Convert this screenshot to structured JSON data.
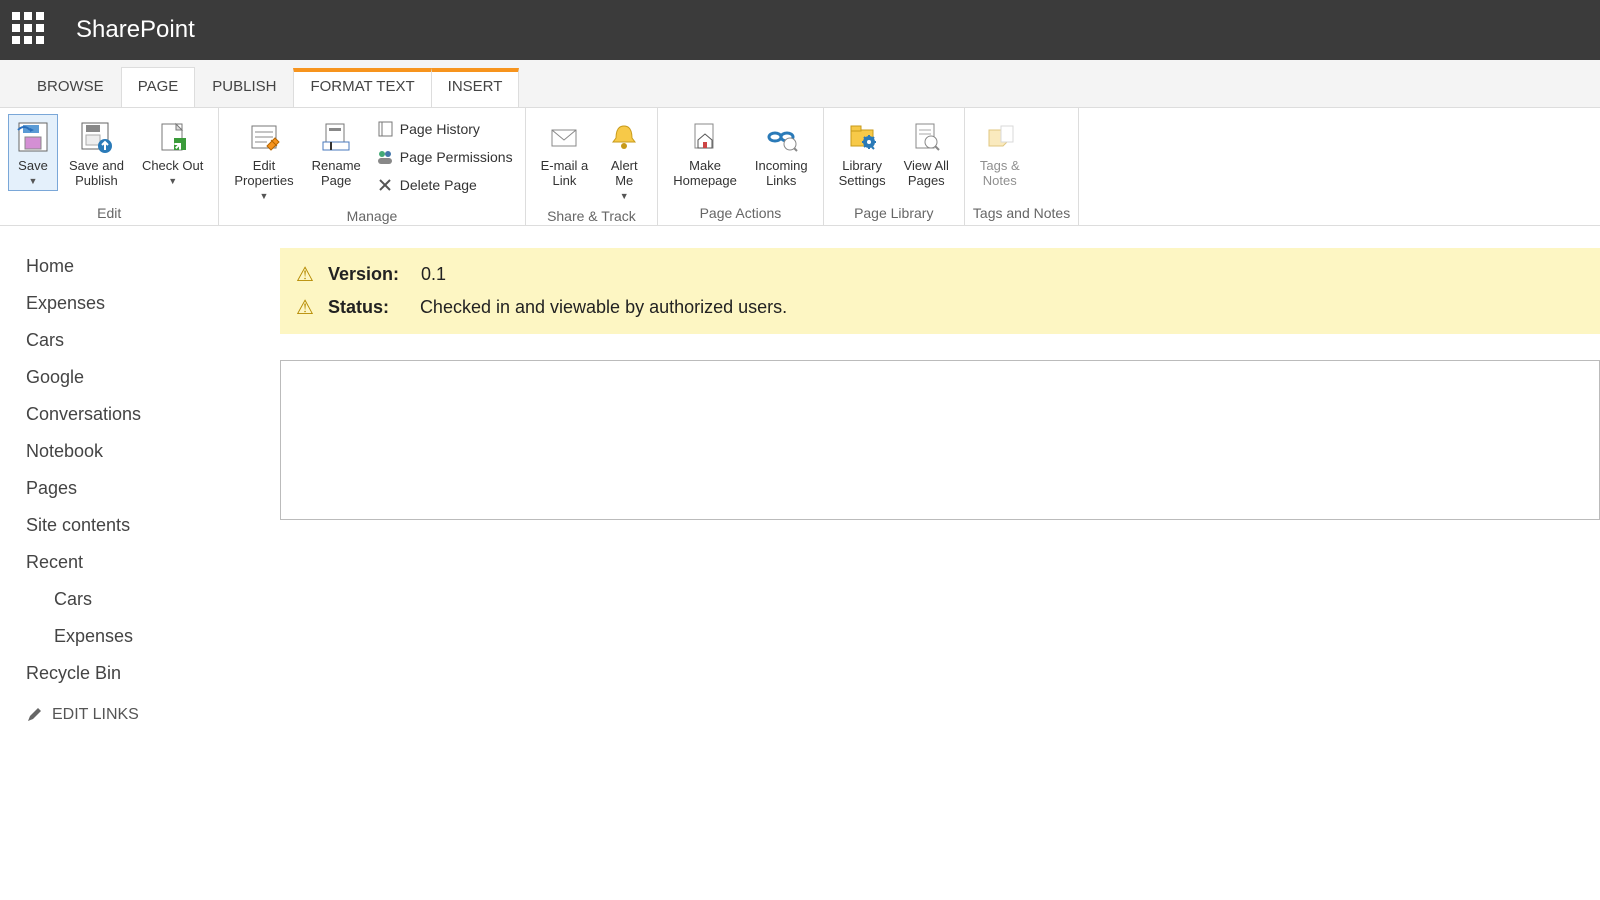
{
  "header": {
    "app": "SharePoint"
  },
  "tabs": [
    {
      "label": "BROWSE",
      "state": ""
    },
    {
      "label": "PAGE",
      "state": "active"
    },
    {
      "label": "PUBLISH",
      "state": ""
    },
    {
      "label": "FORMAT TEXT",
      "state": "highlighted"
    },
    {
      "label": "INSERT",
      "state": "highlighted"
    }
  ],
  "ribbon": {
    "edit": {
      "label": "Edit",
      "save": "Save",
      "save_publish": "Save and\nPublish",
      "checkout": "Check Out"
    },
    "manage": {
      "label": "Manage",
      "edit_props": "Edit\nProperties",
      "rename": "Rename\nPage",
      "history": "Page History",
      "permissions": "Page Permissions",
      "delete": "Delete Page"
    },
    "share": {
      "label": "Share & Track",
      "email": "E-mail a\nLink",
      "alert": "Alert\nMe"
    },
    "actions": {
      "label": "Page Actions",
      "homepage": "Make\nHomepage",
      "incoming": "Incoming\nLinks"
    },
    "library": {
      "label": "Page Library",
      "settings": "Library\nSettings",
      "viewall": "View All\nPages"
    },
    "tags": {
      "label": "Tags and Notes",
      "btn": "Tags &\nNotes"
    }
  },
  "sidebar": {
    "items": [
      "Home",
      "Expenses",
      "Cars",
      "Google",
      "Conversations",
      "Notebook",
      "Pages",
      "Site contents",
      "Recent"
    ],
    "recent": [
      "Cars",
      "Expenses"
    ],
    "recycle": "Recycle Bin",
    "edit_links": "EDIT LINKS"
  },
  "banner": {
    "version_label": "Version:",
    "version_value": "0.1",
    "status_label": "Status:",
    "status_value": "Checked in and viewable by authorized users."
  }
}
